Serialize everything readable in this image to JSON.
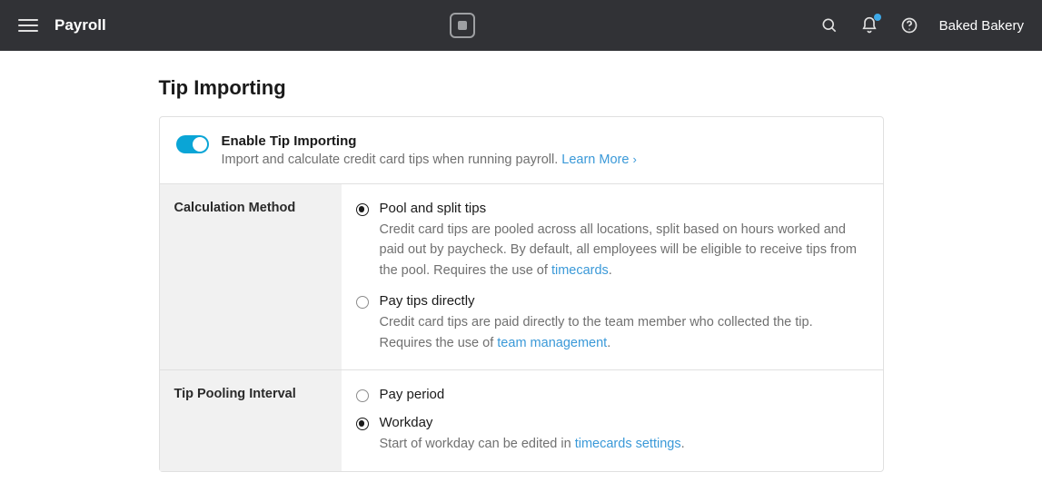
{
  "header": {
    "app_title": "Payroll",
    "business_name": "Baked Bakery"
  },
  "page": {
    "title": "Tip Importing"
  },
  "toggle_section": {
    "enabled": true,
    "title": "Enable Tip Importing",
    "description": "Import and calculate credit card tips when running payroll. ",
    "learn_more_label": "Learn More"
  },
  "sections": [
    {
      "label": "Calculation Method",
      "options": [
        {
          "selected": true,
          "title": "Pool and split tips",
          "desc_before": "Credit card tips are pooled across all locations, split based on hours worked and paid out by paycheck. By default, all employees will be eligible to receive tips from the pool. Requires the use of ",
          "link_text": "timecards",
          "desc_after": "."
        },
        {
          "selected": false,
          "title": "Pay tips directly",
          "desc_before": "Credit card tips are paid directly to the team member who collected the tip. Requires the use of ",
          "link_text": "team management",
          "desc_after": "."
        }
      ]
    },
    {
      "label": "Tip Pooling Interval",
      "options": [
        {
          "selected": false,
          "title": "Pay period",
          "desc_before": "",
          "link_text": "",
          "desc_after": ""
        },
        {
          "selected": true,
          "title": "Workday",
          "desc_before": "Start of workday can be edited in ",
          "link_text": "timecards settings",
          "desc_after": "."
        }
      ]
    }
  ]
}
